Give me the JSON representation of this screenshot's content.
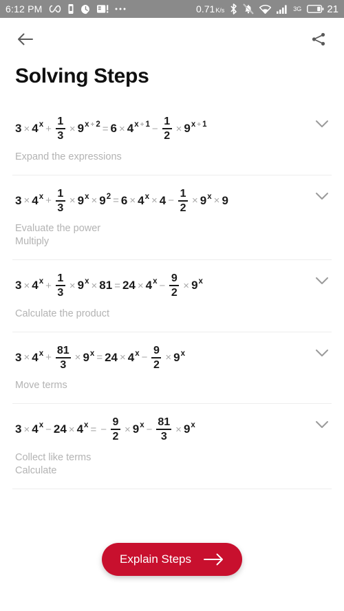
{
  "statusbar": {
    "time": "6:12 PM",
    "left_icons": [
      "infinity-icon",
      "vibrate-icon",
      "alarm-icon",
      "sim-card-icon",
      "more-icon"
    ],
    "network_speed": "0.71",
    "network_speed_unit": "K/s",
    "right_icons": [
      "bluetooth-icon",
      "mute-bell-icon",
      "wifi-icon",
      "signal-bars-icon"
    ],
    "network_type": "3G",
    "battery_level": "21"
  },
  "appbar": {
    "back_icon": "arrow-left-icon",
    "share_icon": "share-icon"
  },
  "page": {
    "title": "Solving Steps"
  },
  "steps": [
    {
      "equation_id": "equation-1",
      "equation_text": "3 × 4^x + 1/3 × 9^(x+2) = 6 × 4^(x+1) − 1/2 × 9^(x+1)",
      "hints": [
        "Expand the expressions"
      ],
      "expand_icon": "chevron-down-icon"
    },
    {
      "equation_id": "equation-2",
      "equation_text": "3 × 4^x + 1/3 × 9^x × 9^2 = 6 × 4^x × 4 − 1/2 × 9^x × 9",
      "hints": [
        "Evaluate the power",
        "Multiply"
      ],
      "expand_icon": "chevron-down-icon"
    },
    {
      "equation_id": "equation-3",
      "equation_text": "3 × 4^x + 1/3 × 9^x × 81 = 24 × 4^x − 9/2 × 9^x",
      "hints": [
        "Calculate the product"
      ],
      "expand_icon": "chevron-down-icon"
    },
    {
      "equation_id": "equation-4",
      "equation_text": "3 × 4^x + 81/3 × 9^x = 24 × 4^x − 9/2 × 9^x",
      "hints": [
        "Move terms"
      ],
      "expand_icon": "chevron-down-icon"
    },
    {
      "equation_id": "equation-5",
      "equation_text": "3 × 4^x − 24 × 4^x = − 9/2 × 9^x − 81/3 × 9^x",
      "hints": [
        "Collect like terms",
        "Calculate"
      ],
      "expand_icon": "chevron-down-icon"
    }
  ],
  "explain_button": {
    "label": "Explain Steps",
    "arrow_icon": "arrow-right-icon",
    "color": "#c8102e"
  },
  "math_tokens": {
    "three": "3",
    "one": "1",
    "two": "2",
    "four": "4",
    "six": "6",
    "nine": "9",
    "x": "x",
    "x81": "81",
    "x24": "24",
    "times": "×",
    "plus": "+",
    "minus": "−",
    "equals": "="
  }
}
